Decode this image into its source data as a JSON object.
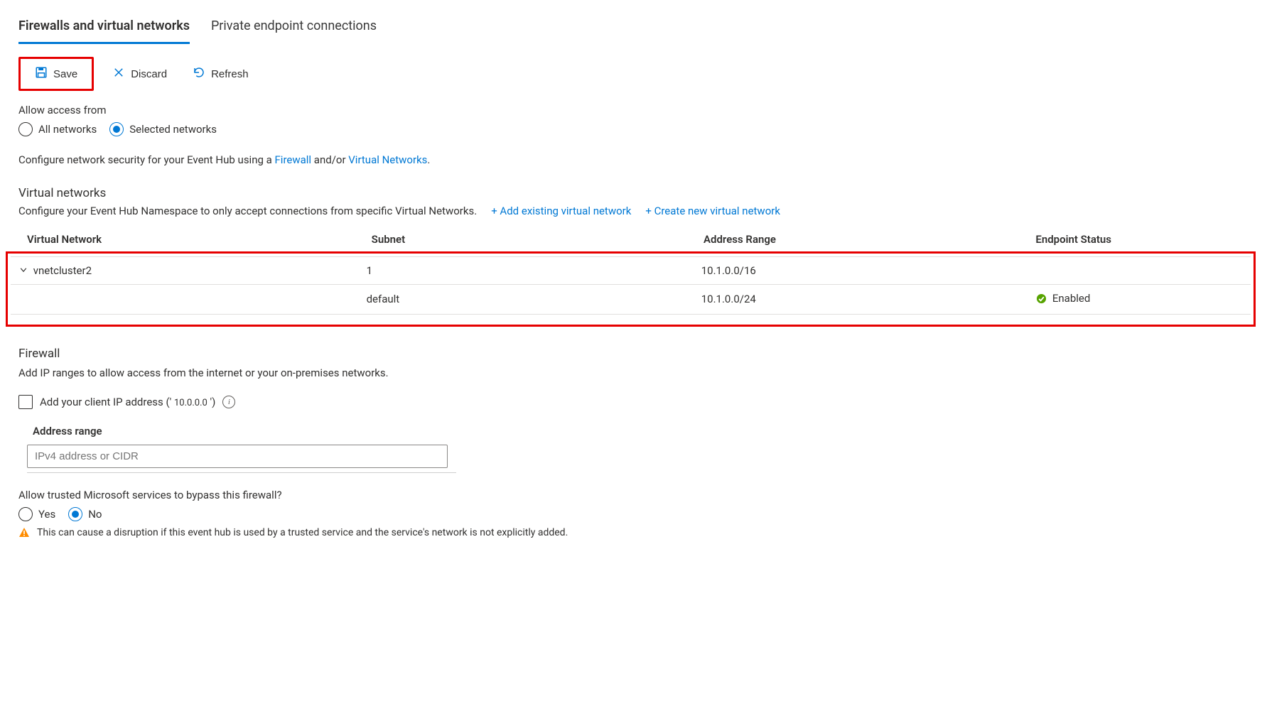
{
  "tabs": {
    "firewalls": "Firewalls and virtual networks",
    "private_endpoints": "Private endpoint connections"
  },
  "toolbar": {
    "save": "Save",
    "discard": "Discard",
    "refresh": "Refresh"
  },
  "access": {
    "label": "Allow access from",
    "all": "All networks",
    "selected": "Selected networks"
  },
  "intro": {
    "prefix": "Configure network security for your Event Hub using a ",
    "firewall": "Firewall",
    "and_or": " and/or ",
    "vnets": "Virtual Networks",
    "suffix": "."
  },
  "vnets": {
    "heading": "Virtual networks",
    "subtext": "Configure your Event Hub Namespace to only accept connections from specific Virtual Networks.",
    "add_existing": "+ Add existing virtual network",
    "create_new": "+ Create new virtual network",
    "columns": {
      "vnet": "Virtual Network",
      "subnet": "Subnet",
      "range": "Address Range",
      "status": "Endpoint Status"
    },
    "rows": [
      {
        "vnet": "vnetcluster2",
        "subnet": "1",
        "range": "10.1.0.0/16",
        "status": ""
      },
      {
        "vnet": "",
        "subnet": "default",
        "range": "10.1.0.0/24",
        "status": "Enabled"
      }
    ]
  },
  "firewall": {
    "heading": "Firewall",
    "subtext": "Add IP ranges to allow access from the internet or your on-premises networks.",
    "add_client_prefix": "Add your client IP address (' ",
    "client_ip": "10.0.0.0",
    "add_client_suffix": "  ')",
    "address_range_label": "Address range",
    "address_range_placeholder": "IPv4 address or CIDR"
  },
  "trusted": {
    "question": "Allow trusted Microsoft services to bypass this firewall?",
    "yes": "Yes",
    "no": "No",
    "warning": "This can cause a disruption if this event hub is used by a trusted service and the service's network is not explicitly added."
  }
}
